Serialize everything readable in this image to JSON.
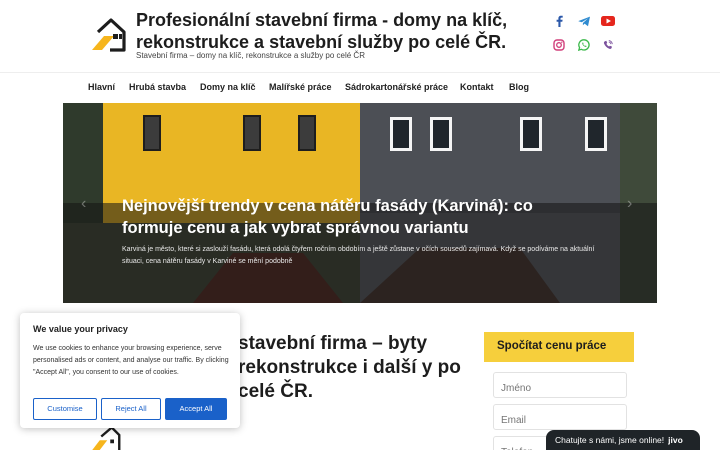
{
  "header": {
    "title": "Profesionální stavební firma - domy na klíč, rekonstrukce a stavební služby po celé ČR.",
    "tagline": "Stavební firma – domy na klíč, rekonstrukce a služby po celé ČR",
    "socials": [
      "facebook-icon",
      "telegram-icon",
      "youtube-icon",
      "instagram-icon",
      "whatsapp-icon",
      "viber-icon"
    ]
  },
  "nav": {
    "items": [
      "Hlavní",
      "Hrubá stavba",
      "Domy na klíč",
      "Malířské práce",
      "Sádrokartonářské práce",
      "Kontakt",
      "Blog"
    ]
  },
  "hero": {
    "title": "Nejnovější trendy v cena nátěru fasády (Karviná): co formuje cenu a jak vybrat správnou variantu",
    "text": "Karviná je město, které si zaslouží fasádu, která odolá čtyřem ročním obdobím a ještě zůstane v očích sousedů zajímavá. Když se podíváme na aktuální situaci, cena nátěru fasády v Karviné se mění podobně"
  },
  "main": {
    "heading": "stavební firma – byty rekonstrukce i další y po celé ČR."
  },
  "widget": {
    "title": "Spočítat cenu práce",
    "name_placeholder": "Jméno",
    "email_placeholder": "Email",
    "phone_placeholder": "Telefon"
  },
  "cookie": {
    "title": "We value your privacy",
    "text": "We use cookies to enhance your browsing experience, serve personalised ads or content, and analyse our traffic. By clicking \"Accept All\", you consent to our use of cookies.",
    "customise": "Customise",
    "reject": "Reject All",
    "accept": "Accept All"
  },
  "chat": {
    "label": "Chatujte s námi, jsme online!",
    "brand": "jivo"
  },
  "colors": {
    "accent_yellow": "#f6cf3c",
    "button_blue": "#1a61c9",
    "chat_dark": "#1f2428"
  }
}
